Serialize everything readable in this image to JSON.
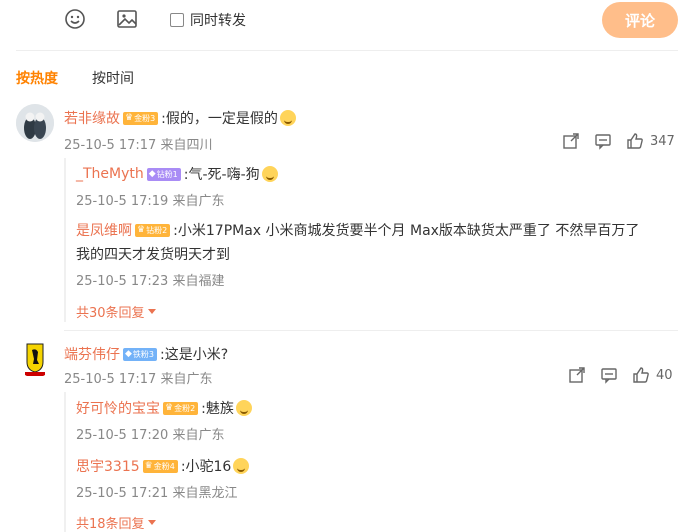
{
  "toolbar": {
    "repost_label": "同时转发",
    "comment_button": "评论",
    "emoji_icon": "emoji-icon",
    "image_icon": "image-icon"
  },
  "sort": {
    "by_hot": "按热度",
    "by_time": "按时间"
  },
  "comments": [
    {
      "user": "若非缘故",
      "badge": "金粉3",
      "text": ":假的，一定是假的",
      "time": "25-10-5 17:17",
      "location": "来自四川",
      "likes": "347",
      "replies": [
        {
          "user": "_TheMyth",
          "badge": "钻粉1",
          "text": ":气-死-嗨-狗",
          "time": "25-10-5 17:19",
          "location": "来自广东"
        },
        {
          "user": "是凤维啊",
          "badge": "钻粉2",
          "text": ":小米17PMax  小米商城发货要半个月 Max版本缺货太严重了 不然早百万了",
          "text2": "我的四天才发货明天才到",
          "time": "25-10-5 17:23",
          "location": "来自福建"
        }
      ],
      "more": "共30条回复"
    },
    {
      "user": "端芬伟仔",
      "badge": "铁粉3",
      "text": ":这是小米?",
      "time": "25-10-5 17:17",
      "location": "来自广东",
      "likes": "40",
      "replies": [
        {
          "user": "好可怜的宝宝",
          "badge": "金粉2",
          "text": ":魅族",
          "time": "25-10-5 17:20",
          "location": "来自广东"
        },
        {
          "user": "思宇3315",
          "badge": "金粉4",
          "text": ":小驼16",
          "time": "25-10-5 17:21",
          "location": "来自黑龙江"
        }
      ],
      "more": "共18条回复"
    }
  ],
  "colors": {
    "accent": "#ff8200",
    "username": "#eb7350",
    "comment_button_bg": "#ffbe8a"
  }
}
